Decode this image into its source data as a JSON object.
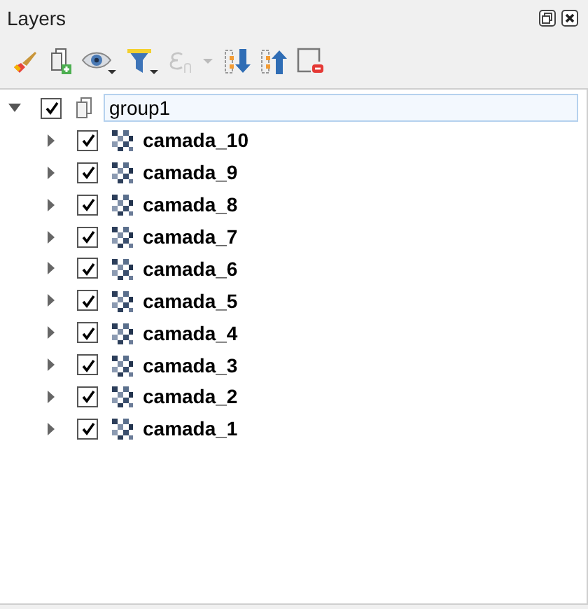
{
  "panel": {
    "title": "Layers"
  },
  "toolbar": [
    {
      "kind": "style",
      "disabled": false
    },
    {
      "kind": "add-group",
      "disabled": false
    },
    {
      "kind": "visibility",
      "disabled": false
    },
    {
      "kind": "filter",
      "disabled": false
    },
    {
      "kind": "expression",
      "disabled": true
    },
    {
      "kind": "expand-all",
      "disabled": false
    },
    {
      "kind": "collapse-all",
      "disabled": false
    },
    {
      "kind": "remove",
      "disabled": false
    }
  ],
  "tree": [
    {
      "label": "group1",
      "checked": true,
      "expanded": true,
      "editing": true,
      "children": [
        {
          "label": "camada_10",
          "checked": true,
          "expanded": false
        },
        {
          "label": "camada_9",
          "checked": true,
          "expanded": false
        },
        {
          "label": "camada_8",
          "checked": true,
          "expanded": false
        },
        {
          "label": "camada_7",
          "checked": true,
          "expanded": false
        },
        {
          "label": "camada_6",
          "checked": true,
          "expanded": false
        },
        {
          "label": "camada_5",
          "checked": true,
          "expanded": false
        },
        {
          "label": "camada_4",
          "checked": true,
          "expanded": false
        },
        {
          "label": "camada_3",
          "checked": true,
          "expanded": false
        },
        {
          "label": "camada_2",
          "checked": true,
          "expanded": false
        },
        {
          "label": "camada_1",
          "checked": true,
          "expanded": false
        }
      ]
    }
  ]
}
